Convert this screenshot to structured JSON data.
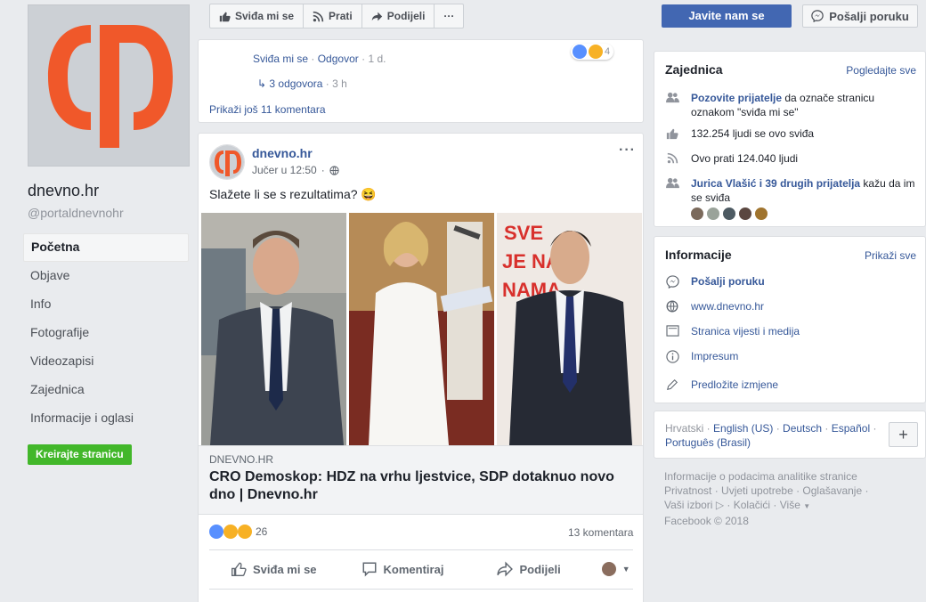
{
  "page": {
    "name": "dnevno.hr",
    "handle": "@portaldnevnohr"
  },
  "nav": {
    "items": [
      {
        "label": "Početna"
      },
      {
        "label": "Objave"
      },
      {
        "label": "Info"
      },
      {
        "label": "Fotografije"
      },
      {
        "label": "Videozapisi"
      },
      {
        "label": "Zajednica"
      },
      {
        "label": "Informacije i oglasi"
      }
    ],
    "create_page": "Kreirajte stranicu"
  },
  "actions": {
    "like": "Sviđa mi se",
    "follow": "Prati",
    "share": "Podijeli",
    "more": "···",
    "contact": "Javite nam se",
    "send_message": "Pošalji poruku"
  },
  "comment": {
    "like": "Sviđa mi se",
    "reply": "Odgovor",
    "age": "1 d.",
    "reaction_count": "4",
    "replies_link": "3 odgovora",
    "replies_age": "3 h",
    "more_comments": "Prikaži još 11 komentara"
  },
  "post": {
    "author": "dnevno.hr",
    "time": "Jučer u 12:50",
    "text": "Slažete li se s rezultatima? 😆",
    "more": "···",
    "link_domain": "DNEVNO.HR",
    "link_title": "CRO Demoskop: HDZ na vrhu ljestvice, SDP dotaknuo novo dno | Dnevno.hr",
    "reaction_count": "26",
    "comments_count": "13 komentara",
    "like_action": "Sviđa mi se",
    "comment_action": "Komentiraj",
    "share_action": "Podijeli",
    "image_sign_text": "SVE\nJE NA\nNAMA"
  },
  "community": {
    "title": "Zajednica",
    "see_all": "Pogledajte sve",
    "invite_link": "Pozovite prijatelje",
    "invite_text": " da označe stranicu oznakom \"sviđa mi se\"",
    "likes": "132.254 ljudi se ovo sviđa",
    "follows": "Ovo prati 124.040 ljudi",
    "friends_link": "Jurica Vlašić i 39 drugih prijatelja",
    "friends_text": " kažu da im se sviđa"
  },
  "info": {
    "title": "Informacije",
    "see_all": "Prikaži sve",
    "send_message": "Pošalji poruku",
    "website": "www.dnevno.hr",
    "category": "Stranica vijesti i medija",
    "impressum": "Impresum",
    "suggest": "Predložite izmjene"
  },
  "languages": {
    "current": "Hrvatski",
    "items": [
      "English (US)",
      "Deutsch",
      "Español",
      "Português (Brasil)"
    ],
    "add": "+"
  },
  "footer": {
    "line1": "Informacije o podacima analitike stranice",
    "privacy": "Privatnost",
    "terms": "Uvjeti upotrebe",
    "ads": "Oglašavanje",
    "ad_choices": "Vaši izbori",
    "more": "Više",
    "copyright": "Facebook © 2018"
  },
  "colors": {
    "brand_blue": "#4267b2",
    "link": "#365899",
    "logo_orange": "#f0582a",
    "create_green": "#42b72a"
  }
}
